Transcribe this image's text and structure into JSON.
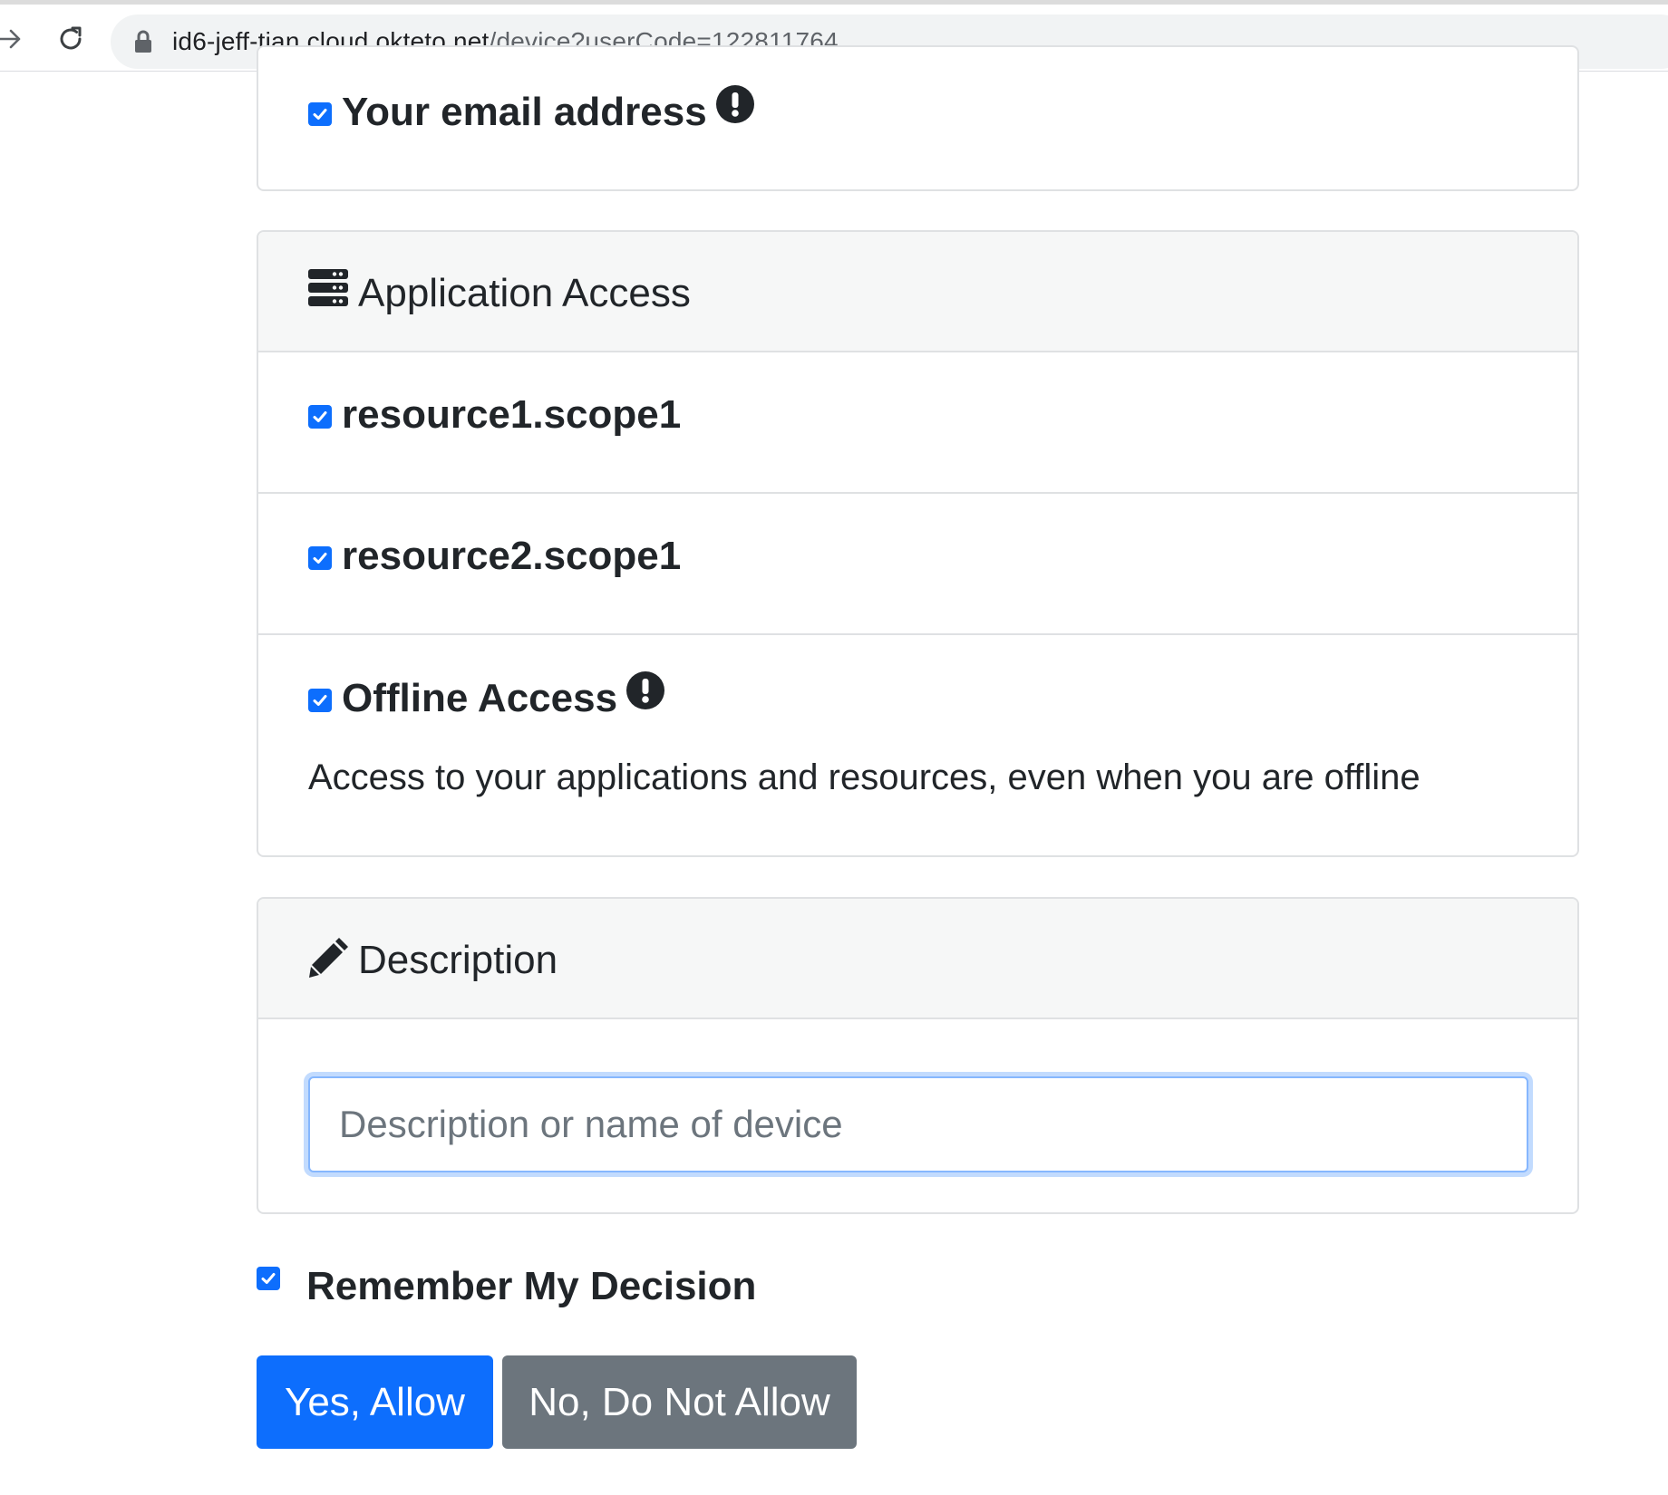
{
  "browser": {
    "url_host": "id6-jeff-tian.cloud.okteto.net",
    "url_path": "/device?userCode=122811764",
    "forward_icon": "arrow-right-icon",
    "reload_icon": "reload-icon",
    "lock_icon": "lock-icon"
  },
  "identity": {
    "items": [
      {
        "label": "Your email address",
        "checked": true,
        "required": true
      }
    ]
  },
  "application_access": {
    "title": "Application Access",
    "icon": "server-icon",
    "scopes": [
      {
        "label": "resource1.scope1",
        "checked": true,
        "required": false
      },
      {
        "label": "resource2.scope1",
        "checked": true,
        "required": false
      },
      {
        "label": "Offline Access",
        "checked": true,
        "required": true,
        "description": "Access to your applications and resources, even when you are offline"
      }
    ]
  },
  "description": {
    "title": "Description",
    "icon": "pencil-icon",
    "placeholder": "Description or name of device",
    "value": ""
  },
  "remember": {
    "label": "Remember My Decision",
    "checked": true
  },
  "buttons": {
    "allow": "Yes, Allow",
    "deny": "No, Do Not Allow"
  },
  "colors": {
    "primary": "#0d6efd",
    "secondary": "#6c757d",
    "text": "#212529",
    "card_header_bg": "#f6f7f7",
    "border": "#dfe1e3",
    "focus_ring": "#c2dbfe"
  }
}
